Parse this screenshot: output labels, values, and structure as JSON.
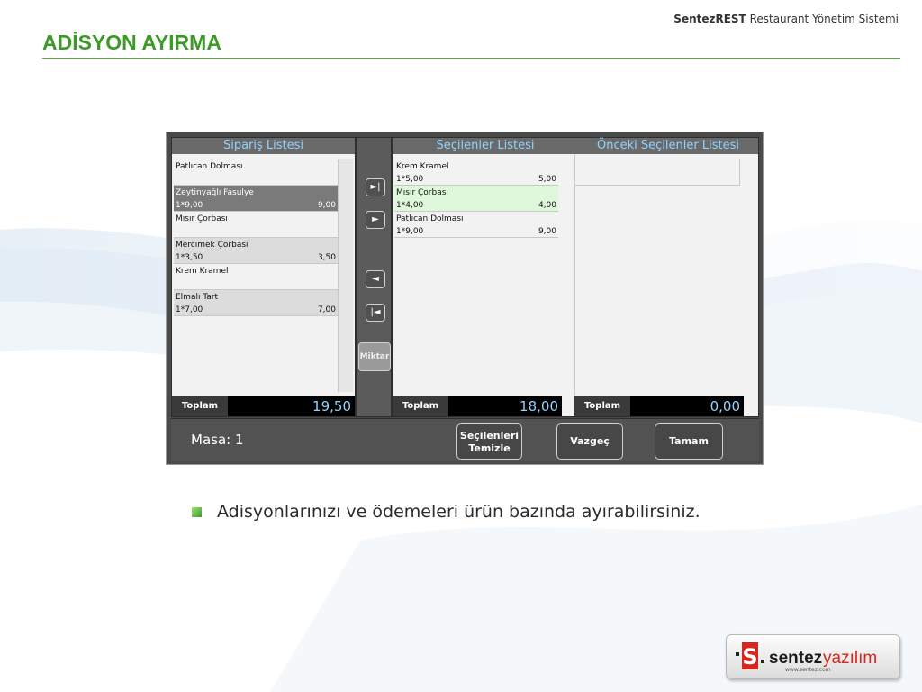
{
  "header": {
    "brand_bold": "SentezREST",
    "brand_rest": " Restaurant Yönetim Sistemi",
    "title": "ADİSYON AYIRMA"
  },
  "app": {
    "siparis": {
      "title": "Sipariş Listesi",
      "items": [
        {
          "name": "Patlıcan Dolması",
          "qty": "",
          "amount": ""
        },
        {
          "name": "Zeytinyağlı Fasulye",
          "qty": "1*9,00",
          "amount": "9,00"
        },
        {
          "name": "Mısır Çorbası",
          "qty": "",
          "amount": ""
        },
        {
          "name": "Mercimek Çorbası",
          "qty": "1*3,50",
          "amount": "3,50"
        },
        {
          "name": "Krem Kramel",
          "qty": "",
          "amount": ""
        },
        {
          "name": "Elmalı Tart",
          "qty": "1*7,00",
          "amount": "7,00"
        }
      ],
      "total_label": "Toplam",
      "total_value": "19,50"
    },
    "secilenler": {
      "title": "Seçilenler Listesi",
      "items": [
        {
          "name": "Krem Kramel",
          "qty": "1*5,00",
          "amount": "5,00"
        },
        {
          "name": "Mısır Çorbası",
          "qty": "1*4,00",
          "amount": "4,00"
        },
        {
          "name": "Patlıcan Dolması",
          "qty": "1*9,00",
          "amount": "9,00"
        }
      ],
      "total_label": "Toplam",
      "total_value": "18,00"
    },
    "onceki": {
      "title": "Önceki Seçilenler Listesi",
      "total_label": "Toplam",
      "total_value": "0,00"
    },
    "mid_buttons": {
      "move_all_right": "►|",
      "move_right": "►",
      "move_left": "◄",
      "move_all_left": "|◄",
      "miktar": "Miktar"
    },
    "bottom": {
      "masa": "Masa: 1",
      "clear_line1": "Seçilenleri",
      "clear_line2": "Temizle",
      "cancel": "Vazgeç",
      "ok": "Tamam"
    }
  },
  "bullet": {
    "text": "Adisyonlarınızı ve ödemeleri ürün bazında ayırabilirsiniz."
  },
  "logo": {
    "mark": "S",
    "word1": "sentez",
    "word2": "yazılım",
    "url": "www.sentez.com"
  },
  "colors": {
    "title_green": "#3c9a27",
    "list_header_text": "#8fd3ff",
    "total_value": "#8fd3ff",
    "logo_red": "#d8261c"
  }
}
